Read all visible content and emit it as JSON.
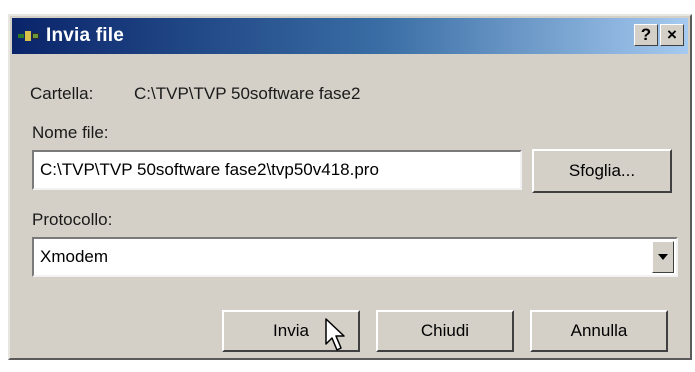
{
  "window": {
    "title": "Invia file",
    "help_label": "?",
    "close_label": "×"
  },
  "folder": {
    "label": "Cartella:",
    "value": "C:\\TVP\\TVP 50software fase2"
  },
  "file": {
    "label": "Nome file:",
    "value": "C:\\TVP\\TVP 50software fase2\\tvp50v418.pro",
    "browse_label": "Sfoglia..."
  },
  "protocol": {
    "label": "Protocollo:",
    "selected": "Xmodem"
  },
  "actions": {
    "send_label": "Invia",
    "close_label": "Chiudi",
    "cancel_label": "Annulla"
  },
  "colors": {
    "title_start": "#0a246a",
    "title_end": "#a6caf0",
    "face": "#d4d0c8"
  },
  "icons": {
    "title": "app-icon",
    "dropdown": "chevron-down-icon",
    "pointer": "mouse-pointer-icon"
  }
}
